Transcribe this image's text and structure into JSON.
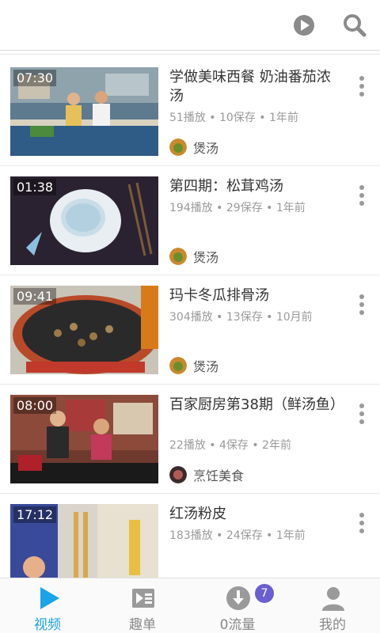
{
  "colors": {
    "accent": "#1aa3e8",
    "badge": "#6a5fd0",
    "meta_text": "#9a9a9a"
  },
  "topbar": {
    "play_icon": "play-circle-icon",
    "search_icon": "search-icon"
  },
  "videos": [
    {
      "duration": "07:30",
      "title": "学做美味西餐 奶油番茄浓汤",
      "meta": "51播放 • 10保存 • 1年前",
      "channel": "煲汤"
    },
    {
      "duration": "01:38",
      "title": "第四期：松茸鸡汤",
      "meta": "194播放 • 29保存 • 1年前",
      "channel": "煲汤"
    },
    {
      "duration": "09:41",
      "title": "玛卡冬瓜排骨汤",
      "meta": "304播放 • 13保存 • 10月前",
      "channel": "煲汤"
    },
    {
      "duration": "08:00",
      "title": "百家厨房第38期（鲜汤鱼）",
      "meta": "22播放 • 4保存 • 2年前",
      "channel": "烹饪美食"
    },
    {
      "duration": "17:12",
      "title": "红汤粉皮",
      "meta": "183播放 • 24保存 • 1年前",
      "channel": ""
    }
  ],
  "bottomnav": {
    "tabs": [
      {
        "label": "视频",
        "icon": "play-triangle-icon",
        "active": true
      },
      {
        "label": "趣单",
        "icon": "playlist-icon",
        "active": false
      },
      {
        "label": "0流量",
        "icon": "download-icon",
        "active": false
      },
      {
        "label": "我的",
        "icon": "user-icon",
        "active": false
      }
    ],
    "download_badge": "7"
  }
}
